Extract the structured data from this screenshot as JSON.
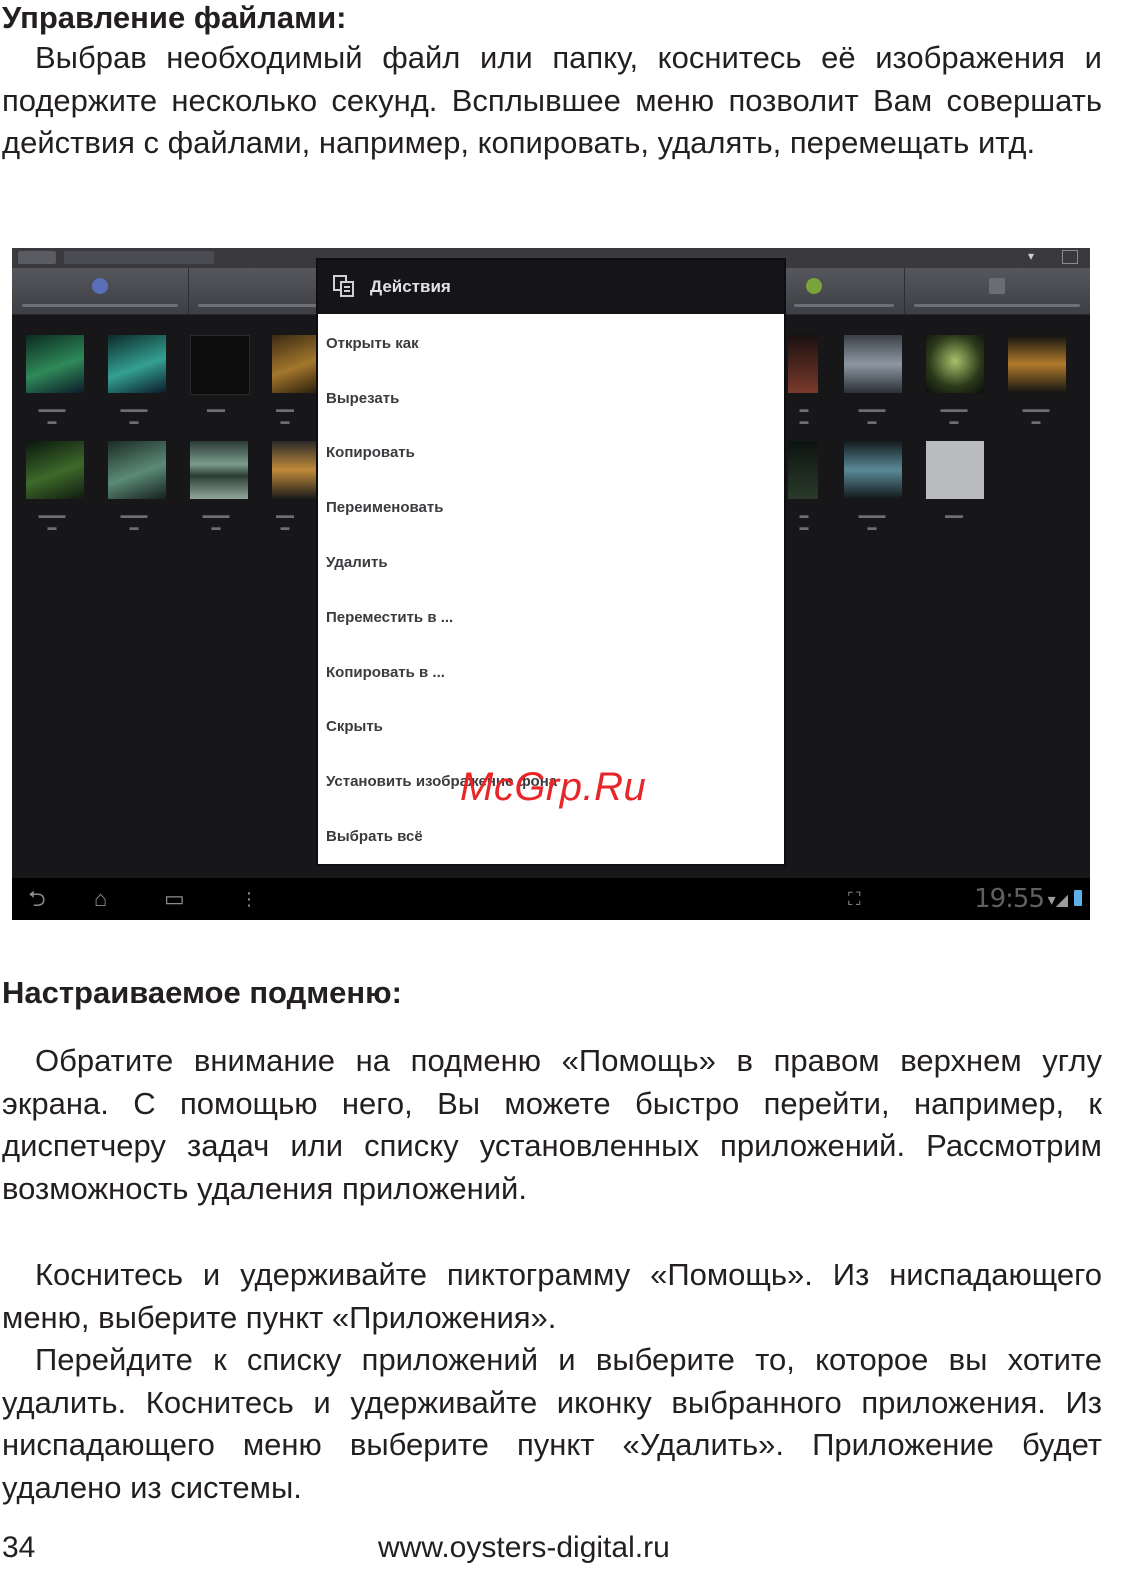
{
  "section1": {
    "heading": "Управление файлами:",
    "paragraph": "Выбрав необходимый файл или папку, коснитесь её изображения и подержите несколько секунд. Всплывшее меню позволит Вам совершать действия с файлами, например, копировать, удалять, перемещать итд."
  },
  "screenshot": {
    "dialog_title": "Действия",
    "menu_items": [
      "Открыть как",
      "Вырезать",
      "Копировать",
      "Переименовать",
      "Удалить",
      "Переместить в ...",
      "Копировать в ...",
      "Скрыть",
      "Установить изображение фона",
      "Выбрать всё"
    ],
    "status_time": "19:55",
    "icons": {
      "back": "back-arrow-icon",
      "home": "home-icon",
      "recent": "recent-apps-icon",
      "menu": "overflow-menu-icon",
      "expand": "expand-icon",
      "wifi": "wifi-icon",
      "signal": "signal-icon",
      "battery": "battery-icon",
      "dialog": "file-actions-icon"
    }
  },
  "watermark": "McGrp.Ru",
  "section2": {
    "heading": "Настраиваемое подменю:",
    "paragraphs": [
      "Обратите внимание на подменю «Помощь» в правом верхнем углу экрана. С помощью него, Вы можете быстро перейти, например, к диспетчеру задач или списку установленных приложений. Рассмотрим возможность удаления приложений.",
      "Коснитесь и удерживайте пиктограмму «Помощь». Из ниспадающего меню, выберите пункт «Приложения».",
      "Перейдите к списку приложений и выберите то, которое вы хотите удалить. Коснитесь и удерживайте иконку выбранного приложения. Из ниспадающего меню выберите пункт «Удалить». Приложение будет удалено из системы."
    ]
  },
  "footer": {
    "page_number": "34",
    "website": "www.oysters-digital.ru"
  }
}
